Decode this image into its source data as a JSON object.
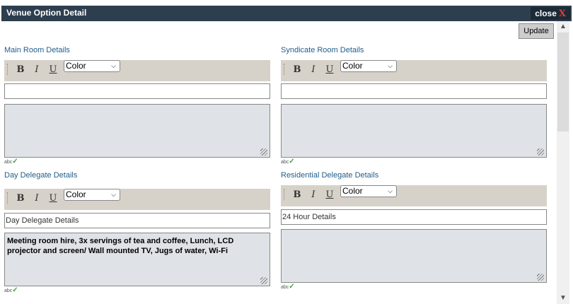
{
  "window": {
    "title": "Venue Option Detail",
    "close_label": "close",
    "close_x": "X"
  },
  "toolbar": {
    "update_label": "Update"
  },
  "editor_tools": {
    "bold": "B",
    "italic": "I",
    "underline": "U",
    "color": "Color",
    "spell": "abc"
  },
  "sections": {
    "main_room": {
      "label": "Main Room Details",
      "subject": "",
      "body": ""
    },
    "syndicate_room": {
      "label": "Syndicate Room Details",
      "subject": "",
      "body": ""
    },
    "day_delegate": {
      "label": "Day Delegate Details",
      "subject": "Day Delegate Details",
      "body": "Meeting room hire, 3x servings of tea and coffee, Lunch, LCD projector and screen/ Wall mounted TV, Jugs of water, Wi-Fi"
    },
    "residential_delegate": {
      "label": "Residential Delegate Details",
      "subject": "24 Hour Details",
      "body": ""
    }
  },
  "colors": {
    "titlebar": "#2d3e4e",
    "label": "#1f5d8a",
    "toolbar": "#d6d2c9",
    "body_bg": "#dfe3e8"
  }
}
